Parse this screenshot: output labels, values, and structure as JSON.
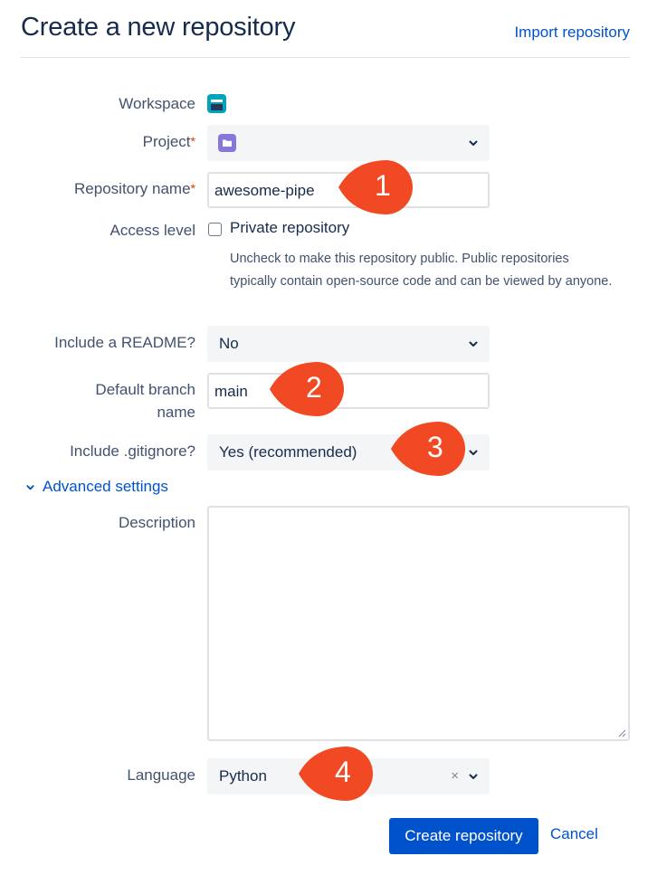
{
  "header": {
    "title": "Create a new repository",
    "import_link": "Import repository"
  },
  "form": {
    "workspace": {
      "label": "Workspace",
      "icon": "workspace-avatar-icon"
    },
    "project": {
      "label": "Project",
      "required_mark": "*",
      "icon": "folder-icon"
    },
    "repo_name": {
      "label": "Repository name",
      "required_mark": "*",
      "value": "awesome-pipe"
    },
    "access": {
      "label": "Access level",
      "checkbox_label": "Private repository",
      "checked": false,
      "help": "Uncheck to make this repository public. Public repositories typically contain open-source code and can be viewed by anyone."
    },
    "readme": {
      "label": "Include a README?",
      "value": "No"
    },
    "branch": {
      "label_line1": "Default branch",
      "label_line2": "name",
      "value": "main"
    },
    "gitignore": {
      "label": "Include .gitignore?",
      "value": "Yes (recommended)"
    },
    "advanced": {
      "label": "Advanced settings",
      "expanded": true
    },
    "description": {
      "label": "Description",
      "value": ""
    },
    "language": {
      "label": "Language",
      "value": "Python",
      "clear": "×"
    }
  },
  "actions": {
    "create": "Create repository",
    "cancel": "Cancel"
  },
  "markers": [
    "1",
    "2",
    "3",
    "4"
  ],
  "colors": {
    "accent": "#0052cc",
    "marker": "#f04923",
    "required": "#de350b",
    "project_icon": "#8777d9",
    "workspace_icon": "#00a3bf"
  }
}
